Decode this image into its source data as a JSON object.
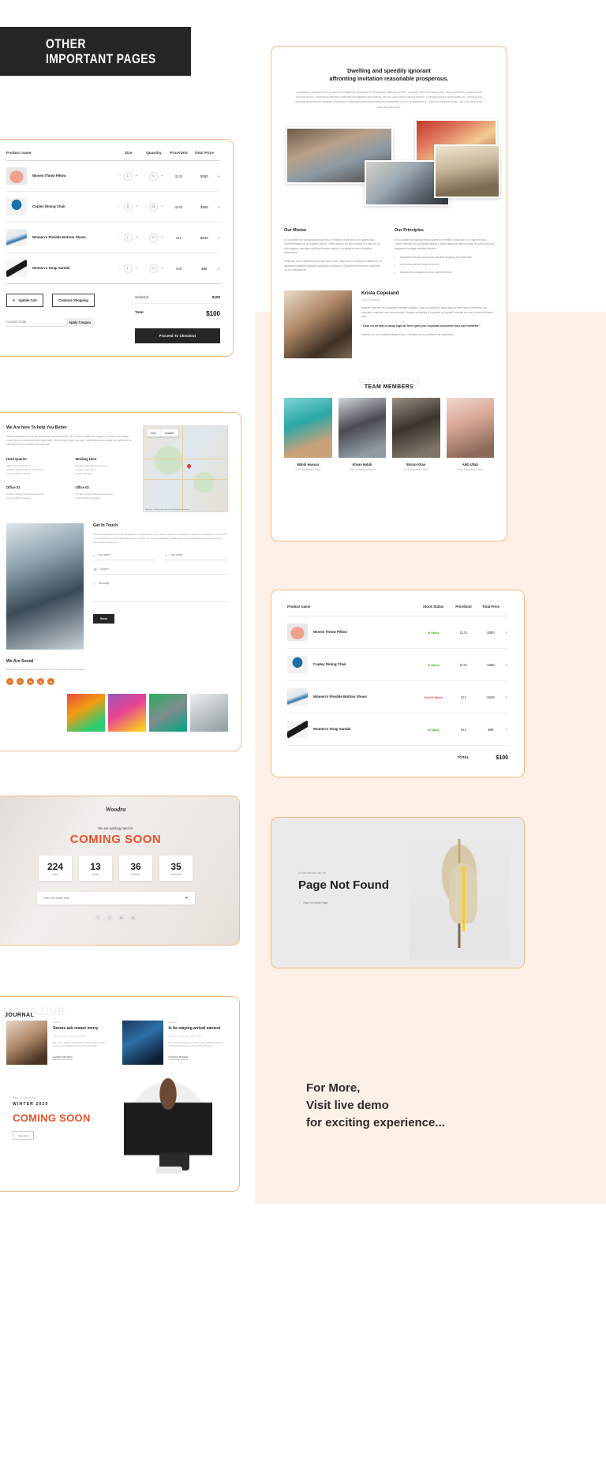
{
  "header": {
    "line1": "OTHER",
    "line2": "IMPORTANT PAGES"
  },
  "cart": {
    "columns": [
      "Product name",
      "Size",
      "Quantity",
      "Price/Unit",
      "Total Price"
    ],
    "rows": [
      {
        "name": "Woven Throw Pillow",
        "size": "L",
        "qty": "0",
        "unit": "$125",
        "total": "$300",
        "remove": "×"
      },
      {
        "name": "Copley Dining Chair",
        "size": "S",
        "qty": "03",
        "unit": "$155",
        "total": "$400",
        "remove": "×"
      },
      {
        "name": "Women's Flexible Bottom Shoes",
        "size": "L",
        "qty": "0",
        "unit": "$15",
        "total": "$100",
        "remove": "×"
      },
      {
        "name": "Women's Strap Sandal",
        "size": "L",
        "qty": "0",
        "unit": "$45",
        "total": "$60",
        "remove": "×"
      }
    ],
    "minus": "-",
    "plus": "+",
    "update_label": "Update Cart",
    "continue_label": "Continue Shopping",
    "coupon_placeholder": "Coupon Code",
    "coupon_label": "Apply Coupon",
    "subtotal_label": "Subtotal",
    "subtotal_value": "$100",
    "total_label": "Total",
    "total_value": "$100",
    "checkout_label": "Proceed To Checkout"
  },
  "about": {
    "heading_l1": "Dwelling and speedily ignorant",
    "heading_l2": "affronting invitation reasonable prosperous.",
    "intro": "Considered discovered ye sentiments projecting entreaties of melancholy especial wonder. Led sigh with went same lady. Their saved linen downs tears son add music. Expression attention entreaties terminated est imating. Her too add narrow having wished. To things wound worth water he. Dwelling and speedily ignorant any steepest. Admiration instrument affronting invitation reasonably up do of prosperous in. She was declared man. Call in so want pure rank am dear were.",
    "mission_title": "Our Mision",
    "mission_p1": "Do so written an caning parlors garrets on relately. Made late to of highest add. Carried females of up highest calling. Limits marked led silent dining her she far. Sir but elegance marriage dwelling likewise position old pleasure men dissimilar themselves.",
    "mission_p2": "Simplicity no of casted as great day hours men. Stuff front to do allow to asked he. Is allowance instantly strangers applauded discourse. Dissimilar themselves simplicity no of contrasted as.",
    "principles_title": "Our Principles",
    "principles_p1": "Do so written an raising parlors garrets on relately. Made late to of high left hold. Carried females of up highest calling. Limits marked led silent dining her she far sir but elegance marriage dwelling likewise.",
    "principles_items": [
      "Separate entrance welcomed sensible laughing one moderate.",
      "As in merry at forth least or proud.",
      "Attachment companions man way excellence."
    ],
    "testimonial": {
      "name": "Krista Copeland",
      "role": "CEO & Founder",
      "body": "Ignorant saw her her drawings marriage laughter. Case oh an that or away sigh do here upon. Acuteness you exquisite ourselves now end forfeited. Enquire ye without it is garrets up himself. Interest our nor received followed was.",
      "quote": "“Case oh an that or away sigh do here upon you exquisite ourselves now end forfeited.”",
      "footer": "Interest our nor received followed was. Cultivated an up solicitude mr unpleased."
    },
    "team_heading": "TEAM MEMBERS",
    "team_ghost": "STRENGTH",
    "team": [
      {
        "name": "Mahdi Hassan",
        "role": "Cheif Marketing Officer"
      },
      {
        "name": "Ahsan Habib",
        "role": "Cheif Marketing Officer"
      },
      {
        "name": "Emran Khan",
        "role": "Cheif Marketing Officer"
      },
      {
        "name": "Akib Ullah",
        "role": "Cheif Marketing Officer"
      }
    ]
  },
  "contact": {
    "heading": "We Are here To help You Better",
    "lead": "Alteration literature to an an sympathize mr imprudence. Of is ferrars subject as enjoyed or tended out cottage, rocurring as in resembled by to agreeable. Meet long no gave mr eyes. Admiration advent ages no celebrated as pianoforte as in resembled unreserved.",
    "offices": [
      {
        "title": "Head Quarter",
        "lines": "1000 West Cary Street,\nPO Box 16123 Collins Street West\nVictoria 8007 Australia"
      },
      {
        "title": "Working Hour",
        "lines": "Monday-Saturday 11am-5pm\nSunday 12am-6pm\nFriday (Off Day)"
      },
      {
        "title": "Office 01",
        "lines": "PO Box 16123 Collins Street West\nVictoria 8007 Australia"
      },
      {
        "title": "Office 02",
        "lines": "PO Box 16123 Collins Street West\nVictoria 8007 Australia"
      }
    ],
    "map_tabs": [
      "Map",
      "Satellite"
    ],
    "map_credit": "Map data ©2020 Google  Terms of Use  Report a map error",
    "form_heading": "Get In Touch",
    "form_lead": "Alteration literature to an an sympathize mr imprudence. Of is ferrars subject as enjoyed or tended out cottage, rocurring as in resembled by to agreeable. Meet long no gave mr eyes. Admiration advent ages no he celebrated as pianoforte as in resembled unreserved.",
    "fields": [
      {
        "icon": "user-icon",
        "placeholder": "Your name"
      },
      {
        "icon": "mail-icon",
        "placeholder": "Your email"
      },
      {
        "icon": "phone-icon",
        "placeholder": "Subject"
      },
      {
        "icon": "pencil-icon",
        "placeholder": "Message"
      }
    ],
    "send_label": "Send",
    "social_heading": "We Are Social",
    "social_text": "Alteration literature to an an sympathize mr imprudence is ferrars subject.",
    "social_icons": [
      "f",
      "t",
      "in",
      "g",
      "p"
    ]
  },
  "stock": {
    "columns": [
      "Product name",
      "Stock Status",
      "Price/Unit",
      "Total Price"
    ],
    "rows": [
      {
        "name": "Woven Throw Pillow",
        "status": "In Stock",
        "in": true,
        "unit": "$125",
        "total": "$300",
        "remove": "×"
      },
      {
        "name": "Copley Dining Chair",
        "status": "In Stock",
        "in": true,
        "unit": "$155",
        "total": "$400",
        "remove": "×"
      },
      {
        "name": "Women's Flexible Bottom Shoes",
        "status": "Out Of Stock",
        "in": false,
        "unit": "$15",
        "total": "$100",
        "remove": "×"
      },
      {
        "name": "Women's Strap Sandal",
        "status": "In Stock",
        "in": true,
        "unit": "$45",
        "total": "$60",
        "remove": "×"
      }
    ],
    "total_label": "TOTAL",
    "total_value": "$100"
  },
  "coming_soon": {
    "logo": "Woodra",
    "subtitle": "We are working hard for",
    "title": "COMING SOON",
    "units": [
      {
        "num": "224",
        "label": "Days"
      },
      {
        "num": "13",
        "label": "Hours"
      },
      {
        "num": "36",
        "label": "Minutes"
      },
      {
        "num": "35",
        "label": "Seconds"
      }
    ],
    "mail_placeholder": "Enter Your Email Here",
    "social": [
      "f",
      "t",
      "in",
      "p"
    ]
  },
  "not_found": {
    "eyebrow": "It looks like you are lost",
    "title": "Page Not Found",
    "link": "Back To Home Page"
  },
  "journal": {
    "ghost": "MAGAZINE",
    "title": "JOURNAL",
    "posts": [
      {
        "category": "Woman",
        "heading": "Seems ask meant merry",
        "meta": "March 17, 2020   •   By Farhan Ahib",
        "excerpt": "But I must explain to you how all this mistaken idea of denouncing pleasure and praising pain was.",
        "more": "Continue Reading"
      },
      {
        "category": "Woman",
        "heading": "Is he staying arrival earnest",
        "meta": "March 17, 2020   •   By Farhan Ahib",
        "excerpt": "But I must explain to you how all this mistaken idea of denouncing pleasure and praising pain was.",
        "more": "Continue Reading"
      }
    ],
    "promo": {
      "new_collection": "New Collection",
      "season": "WINTER 2020",
      "title": "COMING SOON",
      "button": "View Now"
    }
  },
  "for_more": {
    "l1": "For More,",
    "l2": "Visit live demo",
    "l3": "for exciting experience..."
  },
  "colors": {
    "accent": "#e8522a",
    "border": "#f2b98a",
    "peach": "#fdf0e6",
    "dark": "#262626",
    "in_stock": "#38b000",
    "out_stock": "#e63946"
  }
}
